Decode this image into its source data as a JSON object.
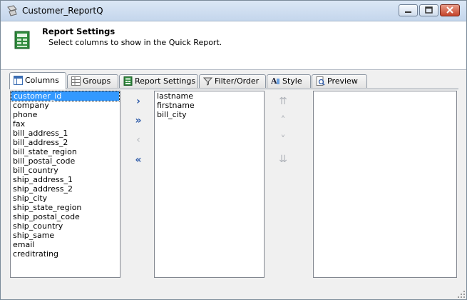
{
  "window": {
    "title": "Customer_ReportQ"
  },
  "header": {
    "title": "Report Settings",
    "subtitle": "Select columns to show in the Quick Report."
  },
  "tabs": [
    {
      "label": "Columns",
      "icon": "columns-icon",
      "active": true
    },
    {
      "label": "Groups",
      "icon": "groups-icon"
    },
    {
      "label": "Report Settings",
      "icon": "report-settings-icon"
    },
    {
      "label": "Filter/Order",
      "icon": "filter-icon"
    },
    {
      "label": "Style",
      "icon": "style-icon"
    },
    {
      "label": "Preview",
      "icon": "preview-icon"
    }
  ],
  "available_columns": {
    "items": [
      "customer_id",
      "company",
      "phone",
      "fax",
      "bill_address_1",
      "bill_address_2",
      "bill_state_region",
      "bill_postal_code",
      "bill_country",
      "ship_address_1",
      "ship_address_2",
      "ship_city",
      "ship_state_region",
      "ship_postal_code",
      "ship_country",
      "ship_same",
      "email",
      "creditrating"
    ],
    "selected": "customer_id"
  },
  "selected_columns": {
    "items": [
      "lastname",
      "firstname",
      "bill_city"
    ]
  },
  "move_buttons": {
    "add": "›",
    "add_all": "»",
    "remove": "‹",
    "remove_all": "«"
  },
  "order_buttons": {
    "top": "⇈",
    "up": "˄",
    "down": "˅",
    "bottom": "⇊"
  },
  "colors": {
    "selection": "#3399ff",
    "arrow_active": "#2d5aa8",
    "arrow_disabled": "#b0b4ba"
  }
}
